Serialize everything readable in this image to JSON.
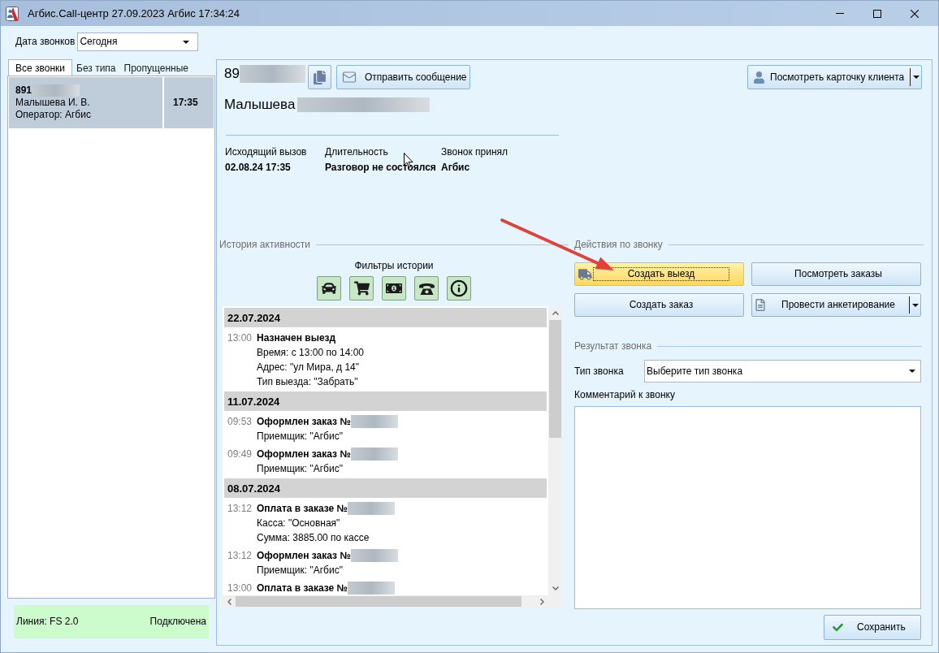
{
  "window": {
    "title": "Агбис.Call-центр 27.09.2023 Агбис 17:34:24"
  },
  "date_filter": {
    "label": "Дата звонков",
    "value": "Сегодня"
  },
  "call_tabs": [
    {
      "label": "Все звонки",
      "selected": true
    },
    {
      "label": "Без типа",
      "selected": false
    },
    {
      "label": "Пропущенные",
      "selected": false
    }
  ],
  "calls": [
    {
      "phone": "891",
      "phone_redacted": true,
      "name": "Малышева И. В.",
      "operator": "Оператор: Агбис",
      "time": "17:35",
      "selected": true
    }
  ],
  "line_status": {
    "line": "Линия: FS 2.0",
    "state": "Подключена"
  },
  "call_card": {
    "phone": "89",
    "phone_redacted": true,
    "send_message_button": "Отправить сообщение",
    "client_card_button": {
      "label": "Посмотреть карточку клиента",
      "dropdown": true
    },
    "client_name": "Малышева",
    "client_name_redacted": true,
    "details": [
      {
        "label": "Исходящий вызов",
        "value": "02.08.24 17:35"
      },
      {
        "label": "Длительность",
        "value": "Разговор не состоялся"
      },
      {
        "label": "Звонок принял",
        "value": "Агбис"
      }
    ]
  },
  "history": {
    "title": "История активности",
    "filters_title": "Фильтры истории",
    "groups": [
      {
        "date": "22.07.2024",
        "entries": [
          {
            "time": "13:00",
            "title": "Назначен выезд",
            "redacted": false,
            "details": [
              "Время: с 13:00 по 14:00",
              "Адрес: \"ул Мира, д 14\"",
              "Тип выезда: \"Забрать\""
            ]
          }
        ]
      },
      {
        "date": "11.07.2024",
        "entries": [
          {
            "time": "09:53",
            "title": "Оформлен заказ №",
            "redacted": true,
            "details": [
              "Приемщик: \"Агбис\""
            ]
          },
          {
            "time": "09:49",
            "title": "Оформлен заказ №",
            "redacted": true,
            "details": [
              "Приемщик: \"Агбис\""
            ]
          }
        ]
      },
      {
        "date": "08.07.2024",
        "entries": [
          {
            "time": "13:12",
            "title": "Оплата в заказе №",
            "redacted": true,
            "details": [
              "Касса: \"Основная\"",
              "Сумма: 3885.00 по кассе"
            ]
          },
          {
            "time": "13:12",
            "title": "Оформлен заказ №",
            "redacted": true,
            "details": [
              "Приемщик: \"Агбис\""
            ]
          },
          {
            "time": "13:00",
            "title": "Оплата в заказе №",
            "redacted": true
          }
        ]
      }
    ]
  },
  "actions": {
    "title": "Действия по звонку",
    "buttons": [
      {
        "label": "Создать выезд",
        "highlighted": true,
        "dropdown": false
      },
      {
        "label": "Посмотреть заказы",
        "highlighted": false,
        "dropdown": false
      },
      {
        "label": "Создать заказ",
        "highlighted": false,
        "dropdown": false
      },
      {
        "label": "Провести анкетирование",
        "highlighted": false,
        "dropdown": true
      }
    ]
  },
  "result": {
    "title": "Результат звонка",
    "call_type": {
      "label": "Тип звонка",
      "value": "Выберите тип звонка"
    },
    "comment": {
      "label": "Комментарий к звонку"
    }
  },
  "save_button": "Сохранить"
}
